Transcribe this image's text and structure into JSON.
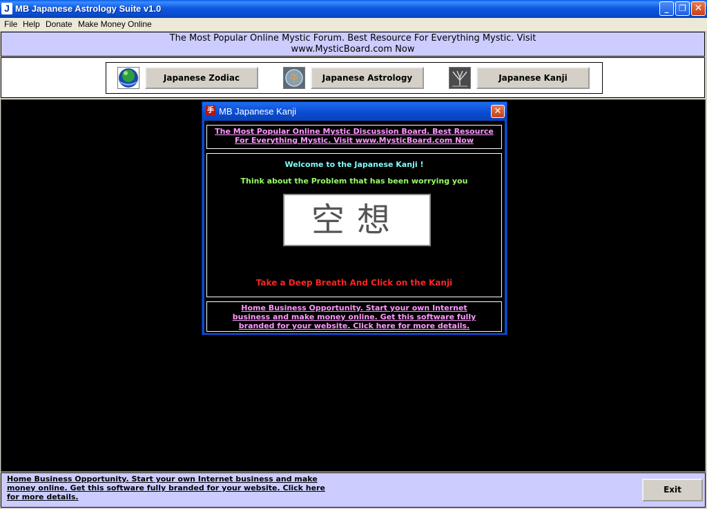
{
  "window": {
    "app_icon": "J",
    "title": "MB Japanese Astrology Suite v1.0",
    "min_glyph": "_",
    "max_glyph": "❐",
    "close_glyph": "✕"
  },
  "menu": [
    "File",
    "Help",
    "Donate",
    "Make Money Online"
  ],
  "top_banner": "The Most Popular Online Mystic Forum. Best Resource For Everything Mystic. Visit www.MysticBoard.com Now",
  "nav": {
    "zodiac": "Japanese Zodiac",
    "astrology": "Japanese Astrology",
    "kanji": "Japanese Kanji"
  },
  "child": {
    "title": "MB Japanese Kanji",
    "icon_glyph": "手",
    "close_glyph": "✕",
    "top_ad": "The Most Popular Online Mystic Discussion Board. Best Resource For Everything Mystic. Visit www.MysticBoard.com Now",
    "welcome": "Welcome to the Japanese Kanji !",
    "think": "Think about the Problem that has been worrying you",
    "kanji": "空想",
    "instruction": "Take a Deep Breath And Click on the Kanji",
    "bottom_ad": "Home Business Opportunity. Start your own Internet business and make money online. Get this software fully branded for your website. Click here for more details."
  },
  "bottom": {
    "ad": "Home Business Opportunity. Start your own Internet business and make money online. Get this software fully branded for your website. Click here for more details.",
    "exit": "Exit"
  },
  "colors": {
    "titlebar": "#0a4cd0",
    "banner": "#ccccff",
    "welcome": "#7fffff",
    "think": "#99ff66",
    "instruction": "#ff2222",
    "ad_link": "#ff99ff"
  }
}
